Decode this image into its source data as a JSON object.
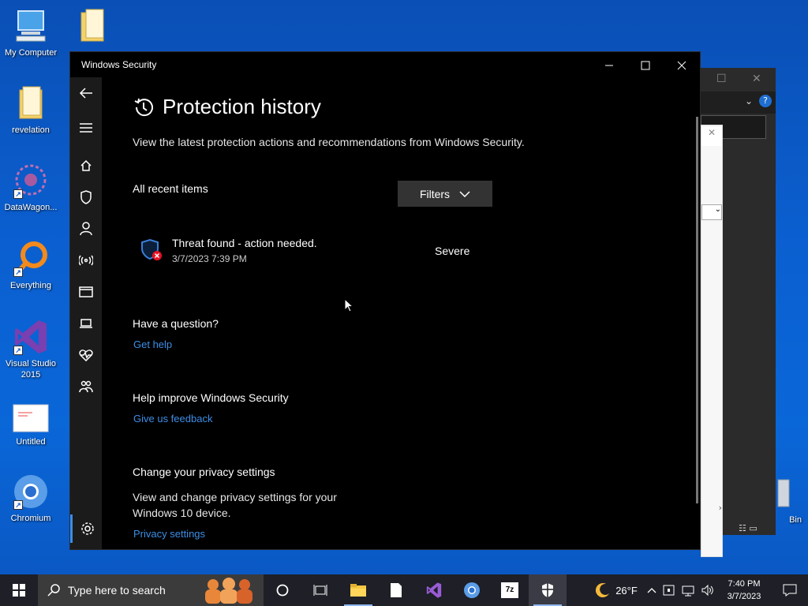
{
  "desktop": {
    "icons": [
      {
        "label": "My Computer"
      },
      {
        "label": "revelation"
      },
      {
        "label": "DataWagon..."
      },
      {
        "label": "Everything"
      },
      {
        "label": "Visual Studio 2015"
      },
      {
        "label": "Untitled"
      },
      {
        "label": "Chromium"
      },
      {
        "label": "Bin"
      }
    ]
  },
  "window": {
    "title": "Windows Security",
    "minimize_icon": "minimize-icon",
    "maximize_icon": "maximize-icon",
    "close_icon": "close-icon"
  },
  "sidebar": {
    "items": [
      {
        "icon": "back-arrow-icon"
      },
      {
        "icon": "hamburger-menu-icon"
      },
      {
        "icon": "home-icon"
      },
      {
        "icon": "shield-icon"
      },
      {
        "icon": "person-icon"
      },
      {
        "icon": "wireless-icon"
      },
      {
        "icon": "app-browser-icon"
      },
      {
        "icon": "laptop-icon"
      },
      {
        "icon": "heart-icon"
      },
      {
        "icon": "family-icon"
      },
      {
        "icon": "gear-icon"
      }
    ]
  },
  "main": {
    "title": "Protection history",
    "description": "View the latest protection actions and recommendations from Windows Security.",
    "recent_label": "All recent items",
    "filters_label": "Filters",
    "threat": {
      "title": "Threat found - action needed.",
      "date": "3/7/2023 7:39 PM",
      "severity": "Severe"
    },
    "question": {
      "heading": "Have a question?",
      "link": "Get help"
    },
    "improve": {
      "heading": "Help improve Windows Security",
      "link": "Give us feedback"
    },
    "privacy": {
      "heading": "Change your privacy settings",
      "text": "View and change privacy settings for your Windows 10 device.",
      "link": "Privacy settings"
    }
  },
  "taskbar": {
    "search_placeholder": "Type here to search",
    "weather": "26°F",
    "time": "7:40 PM",
    "date": "3/7/2023"
  },
  "colors": {
    "accent_link": "#3c8ee6",
    "threat_badge": "#e81123",
    "desktop_bg": "#0a5fd0"
  }
}
